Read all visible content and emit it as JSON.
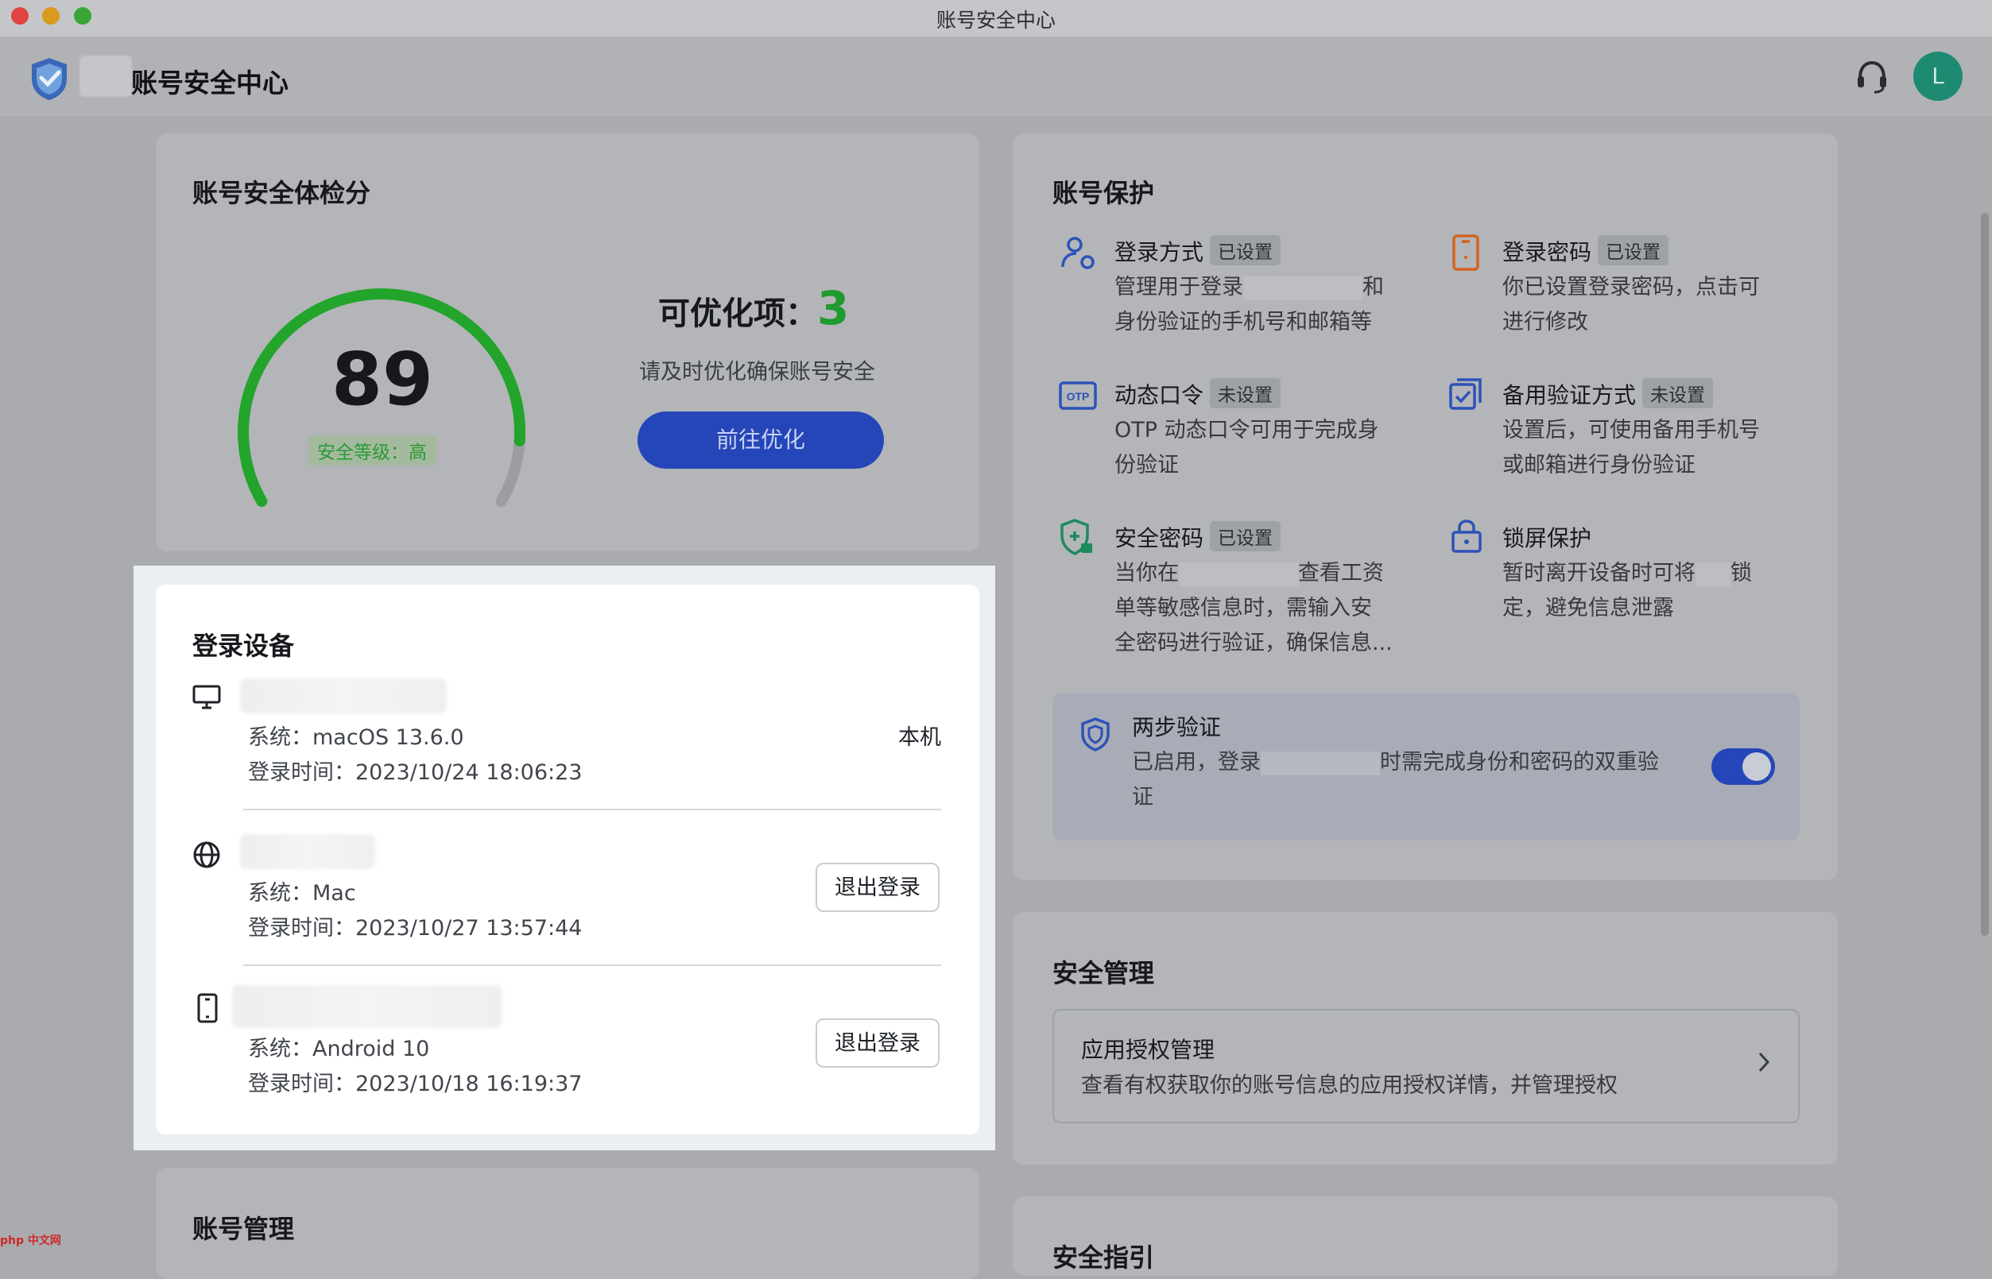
{
  "window": {
    "title": "账号安全中心"
  },
  "header": {
    "app_title": "账号安全中心",
    "avatar_letter": "L"
  },
  "score_card": {
    "title": "账号安全体检分",
    "score": "89",
    "score_value": 89,
    "level_label": "安全等级：高",
    "optimize_label": "可优化项：",
    "optimize_count": "3",
    "tip": "请及时优化确保账号安全",
    "action_label": "前往优化"
  },
  "devices": {
    "title": "登录设备",
    "items": [
      {
        "icon": "monitor-icon",
        "system": "系统：macOS 13.6.0",
        "login_time": "登录时间：2023/10/24 18:06:23",
        "tag": "本机"
      },
      {
        "icon": "globe-icon",
        "system": "系统：Mac",
        "login_time": "登录时间：2023/10/27 13:57:44",
        "action": "退出登录"
      },
      {
        "icon": "phone-icon",
        "system": "系统：Android 10",
        "login_time": "登录时间：2023/10/18 16:19:37",
        "action": "退出登录"
      }
    ]
  },
  "account_mgmt": {
    "title": "账号管理"
  },
  "protection": {
    "title": "账号保护",
    "items": [
      {
        "icon": "user-gear-icon",
        "title": "登录方式",
        "badge": "已设置",
        "desc_1": "管理用于登录",
        "desc_1b": "和",
        "desc_2": "身份验证的手机号和邮箱等"
      },
      {
        "icon": "phone-password-icon",
        "title": "登录密码",
        "badge": "已设置",
        "desc_1": "你已设置登录密码，点击可",
        "desc_2": "进行修改"
      },
      {
        "icon": "otp-icon",
        "title": "动态口令",
        "badge": "未设置",
        "desc_1": "OTP 动态口令可用于完成身",
        "desc_2": "份验证"
      },
      {
        "icon": "backup-verify-icon",
        "title": "备用验证方式",
        "badge": "未设置",
        "desc_1": "设置后，可使用备用手机号",
        "desc_2": "或邮箱进行身份验证"
      },
      {
        "icon": "shield-lock-icon",
        "title": "安全密码",
        "badge": "已设置",
        "desc_1": "当你在",
        "desc_1b": "查看工资",
        "desc_2": "单等敏感信息时，需输入安",
        "desc_3": "全密码进行验证，确保信息..."
      },
      {
        "icon": "lock-screen-icon",
        "title": "锁屏保护",
        "badge": "",
        "desc_1": "暂时离开设备时可将",
        "desc_1b": "锁",
        "desc_2": "定，避免信息泄露"
      }
    ],
    "two_step": {
      "title": "两步验证",
      "desc_1": "已启用，登录",
      "desc_1b": "时需完成身份和密码的双重验",
      "desc_2": "证",
      "enabled": true
    }
  },
  "security_mgmt": {
    "title": "安全管理",
    "app_auth": {
      "title": "应用授权管理",
      "desc": "查看有权获取你的账号信息的应用授权详情，并管理授权"
    }
  },
  "guide": {
    "title": "安全指引"
  },
  "colors": {
    "accent": "#2546b8",
    "gauge": "#22a52a",
    "score_green": "#1f9a2e"
  }
}
